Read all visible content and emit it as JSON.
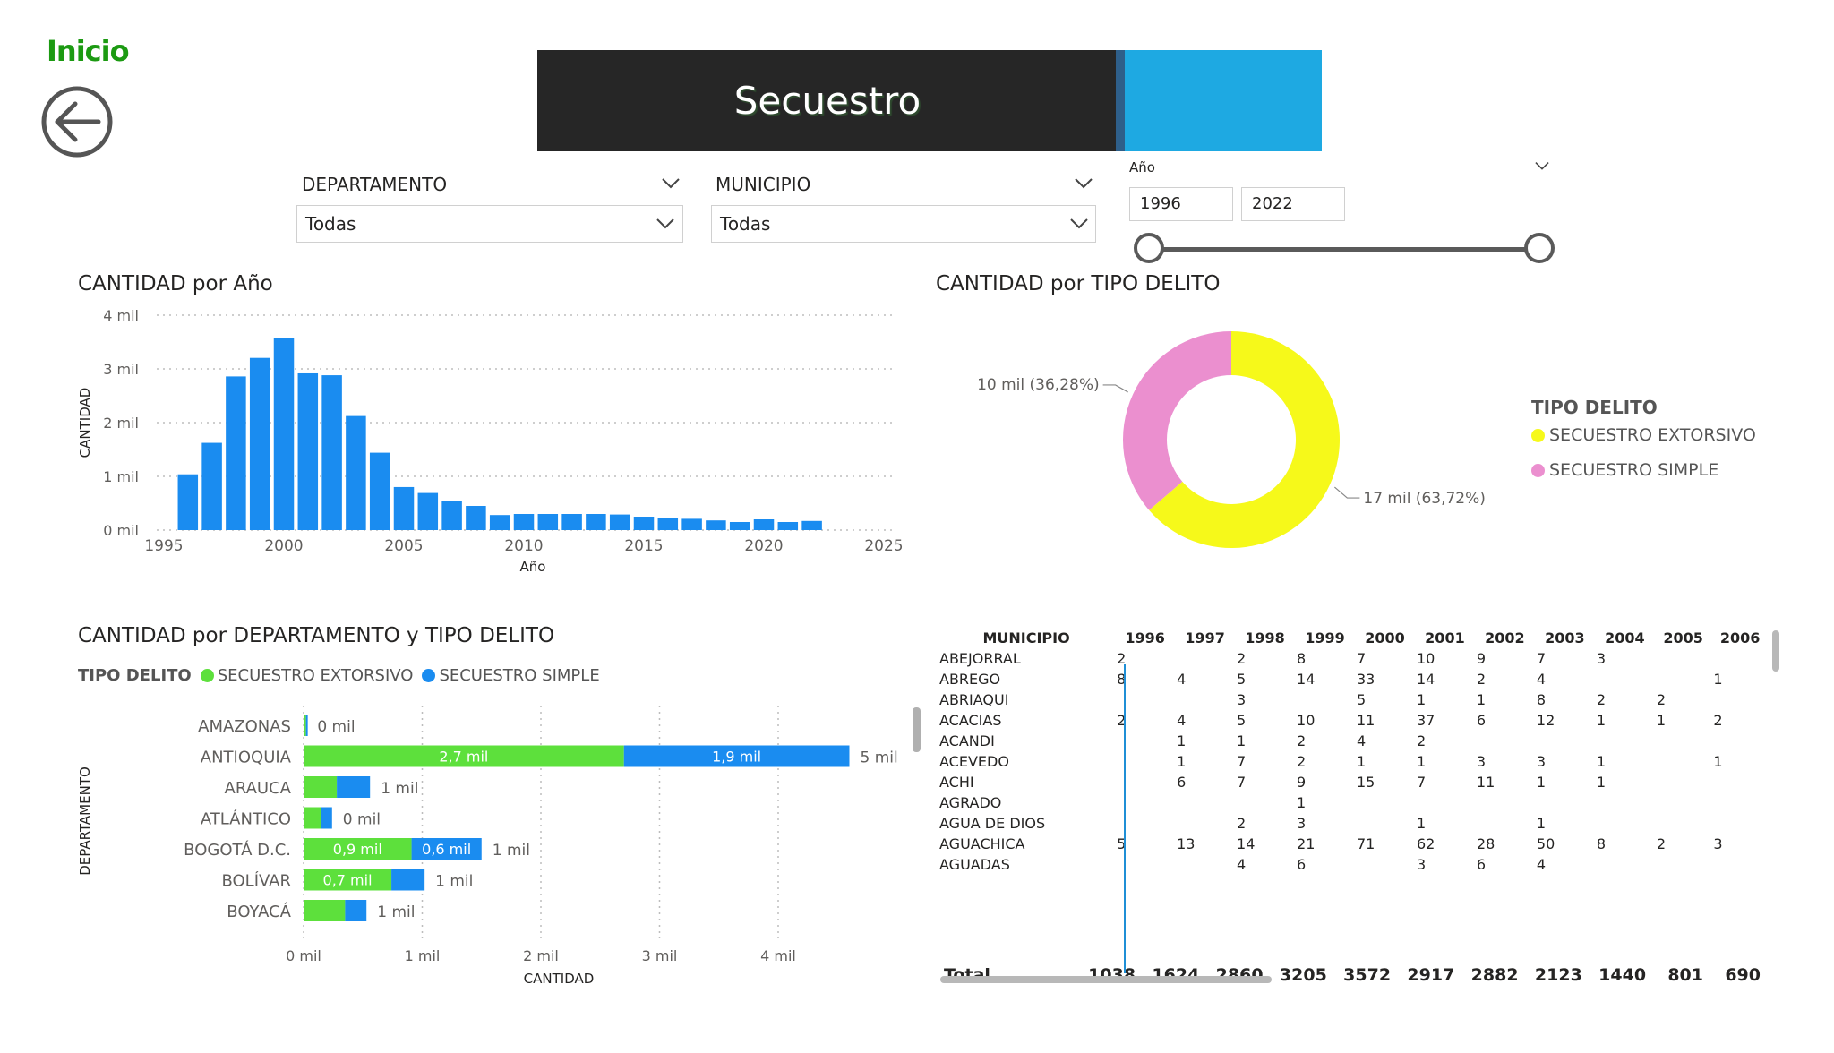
{
  "nav": {
    "inicio_label": "Inicio",
    "back_icon": "arrow-left-circle-icon"
  },
  "header": {
    "title": "Secuestro",
    "bar_color": "#262626",
    "accent_color": "#1ea9e2"
  },
  "filters": {
    "departamento": {
      "label": "DEPARTAMENTO",
      "value": "Todas"
    },
    "municipio": {
      "label": "MUNICIPIO",
      "value": "Todas"
    },
    "anio": {
      "label": "Año",
      "from": "1996",
      "to": "2022"
    }
  },
  "colors": {
    "bar_blue": "#1a8cf0",
    "extorsivo_green": "#5de03c",
    "extorsivo_yellow": "#f6f91a",
    "simple_pink": "#eb8fcf",
    "simple_blue": "#1a8cf0"
  },
  "chart_data": [
    {
      "type": "bar",
      "title": "CANTIDAD por Año",
      "xlabel": "Año",
      "ylabel": "CANTIDAD",
      "x_ticks": [
        "1995",
        "2000",
        "2005",
        "2010",
        "2015",
        "2020",
        "2025"
      ],
      "y_ticks": [
        "0 mil",
        "1 mil",
        "2 mil",
        "3 mil",
        "4 mil"
      ],
      "xlim": [
        1995,
        2025
      ],
      "ylim": [
        0,
        4000
      ],
      "grid": true,
      "x": [
        1996,
        1997,
        1998,
        1999,
        2000,
        2001,
        2002,
        2003,
        2004,
        2005,
        2006,
        2007,
        2008,
        2009,
        2010,
        2011,
        2012,
        2013,
        2014,
        2015,
        2016,
        2017,
        2018,
        2019,
        2020,
        2021,
        2022
      ],
      "values": [
        1038,
        1624,
        2860,
        3205,
        3572,
        2917,
        2882,
        2123,
        1440,
        801,
        690,
        540,
        450,
        280,
        300,
        300,
        300,
        300,
        290,
        250,
        230,
        210,
        180,
        150,
        200,
        150,
        170
      ]
    },
    {
      "type": "pie",
      "title": "CANTIDAD por TIPO DELITO",
      "legend_title": "TIPO DELITO",
      "legend_position": "right",
      "slices": [
        {
          "name": "SECUESTRO EXTORSIVO",
          "percent": 63.72,
          "label": "17 mil (63,72%)",
          "color": "#f6f91a"
        },
        {
          "name": "SECUESTRO SIMPLE",
          "percent": 36.28,
          "label": "10 mil (36,28%)",
          "color": "#eb8fcf"
        }
      ]
    },
    {
      "type": "bar",
      "orientation": "horizontal",
      "stacked": true,
      "title": "CANTIDAD por DEPARTAMENTO y TIPO DELITO",
      "legend_title": "TIPO DELITO",
      "legend_position": "top-left",
      "xlabel": "CANTIDAD",
      "ylabel": "DEPARTAMENTO",
      "x_ticks": [
        "0 mil",
        "1 mil",
        "2 mil",
        "3 mil",
        "4 mil"
      ],
      "xlim": [
        0,
        4600
      ],
      "categories": [
        "AMAZONAS",
        "ANTIOQUIA",
        "ARAUCA",
        "ATLÁNTICO",
        "BOGOTÁ D.C.",
        "BOLÍVAR",
        "BOYACÁ"
      ],
      "series": [
        {
          "name": "SECUESTRO EXTORSIVO",
          "values": [
            20,
            2700,
            280,
            150,
            910,
            740,
            350
          ],
          "labels": [
            "",
            "2,7 mil",
            "",
            "",
            "0,9 mil",
            "0,7 mil",
            ""
          ]
        },
        {
          "name": "SECUESTRO SIMPLE",
          "values": [
            5,
            1900,
            280,
            90,
            590,
            280,
            180
          ],
          "labels": [
            "",
            "1,9 mil",
            "",
            "",
            "0,6 mil",
            "",
            ""
          ]
        }
      ],
      "total_labels": [
        "0 mil",
        "5 mil",
        "1 mil",
        "0 mil",
        "1 mil",
        "1 mil",
        "1 mil"
      ]
    }
  ],
  "matrix": {
    "headers": [
      "MUNICIPIO",
      "1996",
      "1997",
      "1998",
      "1999",
      "2000",
      "2001",
      "2002",
      "2003",
      "2004",
      "2005",
      "2006"
    ],
    "rows": [
      [
        "ABEJORRAL",
        "2",
        "",
        "2",
        "8",
        "7",
        "10",
        "9",
        "7",
        "3",
        "",
        ""
      ],
      [
        "ABREGO",
        "8",
        "4",
        "5",
        "14",
        "33",
        "14",
        "2",
        "4",
        "",
        "",
        "1"
      ],
      [
        "ABRIAQUI",
        "",
        "",
        "3",
        "",
        "5",
        "1",
        "1",
        "8",
        "2",
        "2",
        ""
      ],
      [
        "ACACIAS",
        "2",
        "4",
        "5",
        "10",
        "11",
        "37",
        "6",
        "12",
        "1",
        "1",
        "2"
      ],
      [
        "ACANDI",
        "",
        "1",
        "1",
        "2",
        "4",
        "2",
        "",
        "",
        "",
        "",
        ""
      ],
      [
        "ACEVEDO",
        "",
        "1",
        "7",
        "2",
        "1",
        "1",
        "3",
        "3",
        "1",
        "",
        "1"
      ],
      [
        "ACHI",
        "",
        "6",
        "7",
        "9",
        "15",
        "7",
        "11",
        "1",
        "1",
        "",
        ""
      ],
      [
        "AGRADO",
        "",
        "",
        "",
        "1",
        "",
        "",
        "",
        "",
        "",
        "",
        ""
      ],
      [
        "AGUA DE DIOS",
        "",
        "",
        "2",
        "3",
        "",
        "1",
        "",
        "1",
        "",
        "",
        ""
      ],
      [
        "AGUACHICA",
        "5",
        "13",
        "14",
        "21",
        "71",
        "62",
        "28",
        "50",
        "8",
        "2",
        "3"
      ],
      [
        "AGUADAS",
        "",
        "",
        "4",
        "6",
        "",
        "3",
        "6",
        "4",
        "",
        "",
        ""
      ]
    ],
    "total": [
      "Total",
      "1038",
      "1624",
      "2860",
      "3205",
      "3572",
      "2917",
      "2882",
      "2123",
      "1440",
      "801",
      "690"
    ]
  }
}
